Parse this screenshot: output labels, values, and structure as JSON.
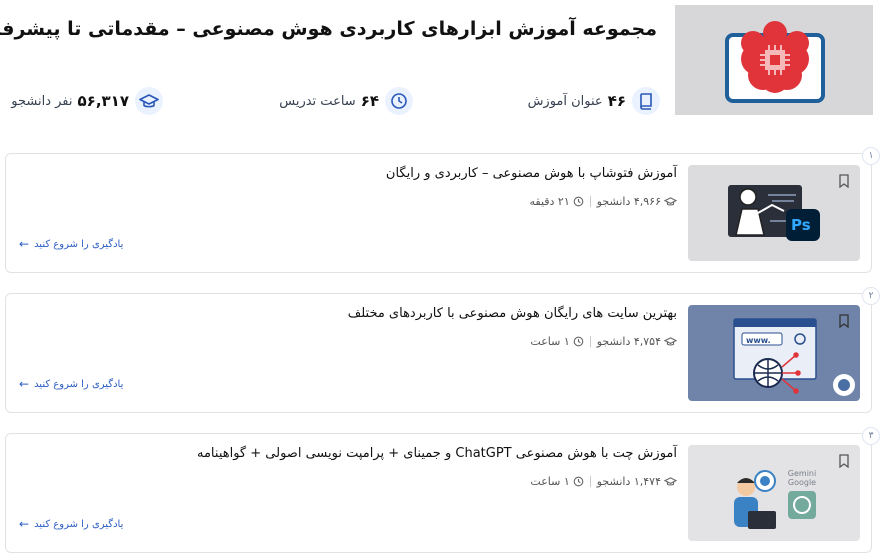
{
  "collection": {
    "title": "مجموعه آموزش ابزارهای کاربردی هوش مصنوعی – مقدماتی تا پیشرفته",
    "stats": {
      "courses": {
        "value": "۴۶",
        "label": "عنوان آموزش",
        "icon": "book-icon"
      },
      "hours": {
        "value": "۶۴",
        "label": "ساعت تدریس",
        "icon": "clock-icon"
      },
      "students": {
        "value": "۵۶,۳۱۷",
        "label": "نفر دانشجو",
        "icon": "graduation-cap-icon"
      }
    }
  },
  "courses": [
    {
      "index": "۱",
      "title": "آموزش فتوشاپ با هوش مصنوعی – کاربردی و رایگان",
      "students": "۴,۹۶۶ دانشجو",
      "duration": "۲۱ دقیقه",
      "cta": "یادگیری را شروع کنید",
      "thumb_badge": "Ps"
    },
    {
      "index": "۲",
      "title": "بهترین سایت های رایگان هوش مصنوعی با کاربردهای مختلف",
      "students": "۴,۷۵۴ دانشجو",
      "duration": "۱ ساعت",
      "cta": "یادگیری را شروع کنید",
      "thumb_badge": "www."
    },
    {
      "index": "۳",
      "title": "آموزش چت با هوش مصنوعی ChatGPT و جمینای + پرامپت نویسی اصولی + گواهینامه",
      "students": "۱,۴۷۴ دانشجو",
      "duration": "۱ ساعت",
      "cta": "یادگیری را شروع کنید",
      "thumb_badge": "Gemini Google"
    }
  ],
  "colors": {
    "accent": "#2d5fc4",
    "brain_red": "#e0343a",
    "icon_blue": "#2a58b8",
    "icon_bg": "#eaf1ff"
  }
}
